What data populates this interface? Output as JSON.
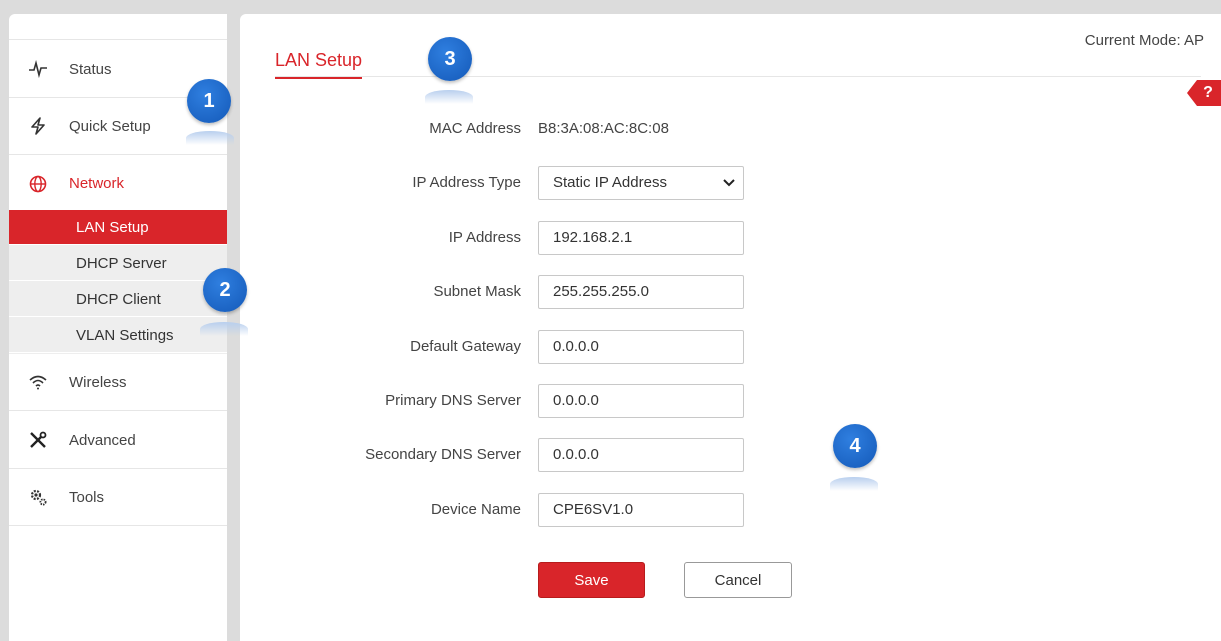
{
  "mode": {
    "label": "Current Mode: AP"
  },
  "sidebar": {
    "items": [
      {
        "label": "Status",
        "icon": "pulse-icon"
      },
      {
        "label": "Quick Setup",
        "icon": "bolt-icon"
      },
      {
        "label": "Network",
        "icon": "globe-icon"
      },
      {
        "label": "Wireless",
        "icon": "wifi-icon"
      },
      {
        "label": "Advanced",
        "icon": "tools-icon"
      },
      {
        "label": "Tools",
        "icon": "gears-icon"
      }
    ],
    "network_sub": [
      {
        "label": "LAN Setup"
      },
      {
        "label": "DHCP Server"
      },
      {
        "label": "DHCP Client"
      },
      {
        "label": "VLAN Settings"
      }
    ]
  },
  "page": {
    "title": "LAN Setup",
    "help": "?"
  },
  "form": {
    "mac_label": "MAC Address",
    "mac_value": "B8:3A:08:AC:8C:08",
    "ip_type_label": "IP Address Type",
    "ip_type_value": "Static IP Address",
    "ip_label": "IP Address",
    "ip_value": "192.168.2.1",
    "mask_label": "Subnet Mask",
    "mask_value": "255.255.255.0",
    "gateway_label": "Default Gateway",
    "gateway_value": "0.0.0.0",
    "dns1_label": "Primary DNS Server",
    "dns1_value": "0.0.0.0",
    "dns2_label": "Secondary DNS Server",
    "dns2_value": "0.0.0.0",
    "name_label": "Device Name",
    "name_value": "CPE6SV1.0",
    "save": "Save",
    "cancel": "Cancel"
  },
  "callouts": [
    "1",
    "2",
    "3",
    "4"
  ],
  "colors": {
    "accent": "#d9252a",
    "callout": "#1a63c7"
  }
}
